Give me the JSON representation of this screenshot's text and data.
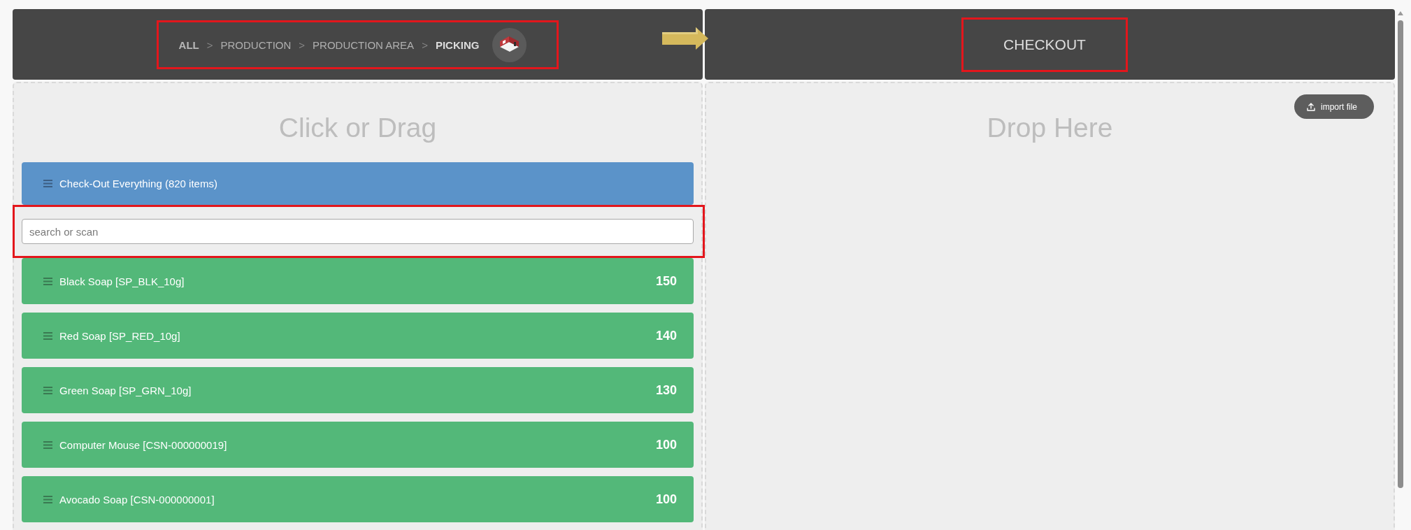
{
  "source_header": {
    "highlighted": true,
    "breadcrumb": [
      {
        "kind": "root",
        "label": "ALL",
        "current": false
      },
      {
        "kind": "separator",
        "label": ">"
      },
      {
        "kind": "crumb",
        "label": "PRODUCTION",
        "current": false
      },
      {
        "kind": "separator",
        "label": ">"
      },
      {
        "kind": "crumb",
        "label": "PRODUCTION AREA",
        "current": false
      },
      {
        "kind": "separator",
        "label": ">"
      },
      {
        "kind": "crumb",
        "label": "PICKING",
        "current": true
      }
    ]
  },
  "target_header": {
    "title": "CHECKOUT",
    "highlighted": true
  },
  "source_panel": {
    "title": "Click or Drag",
    "checkout_all": "Check-Out Everything (820 items)",
    "search": {
      "placeholder": "search or scan",
      "highlighted": true
    },
    "items": [
      {
        "name": "Black Soap [SP_BLK_10g]",
        "quantity": "150"
      },
      {
        "name": "Red Soap [SP_RED_10g]",
        "quantity": "140"
      },
      {
        "name": "Green Soap [SP_GRN_10g]",
        "quantity": "130"
      },
      {
        "name": "Computer Mouse [CSN-000000019]",
        "quantity": "100"
      },
      {
        "name": "Avocado Soap [CSN-000000001]",
        "quantity": "100"
      }
    ]
  },
  "target_panel": {
    "title": "Drop Here",
    "import_button": "import file"
  }
}
